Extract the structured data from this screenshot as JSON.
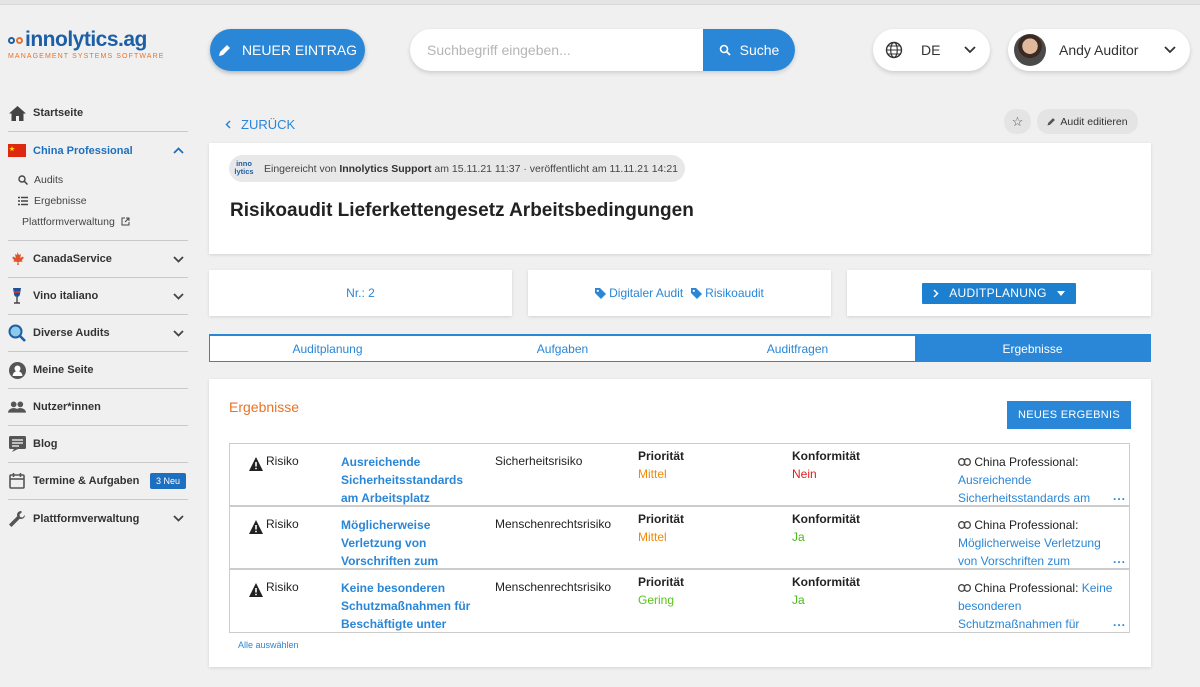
{
  "brand": {
    "name": "innolytics.ag",
    "tagline": "MANAGEMENT SYSTEMS SOFTWARE",
    "logo_icon": "innolytics-logo-icon"
  },
  "header": {
    "new_entry_label": "NEUER EINTRAG",
    "search_placeholder": "Suchbegriff eingeben...",
    "search_button_label": "Suche",
    "language": "DE",
    "user_name": "Andy Auditor"
  },
  "sidebar": {
    "items": [
      {
        "label": "Startseite",
        "icon": "home-icon"
      },
      {
        "label": "China Professional",
        "icon": "china-flag-icon",
        "expanded": true,
        "sub": [
          {
            "label": "Audits",
            "icon": "search-icon"
          },
          {
            "label": "Ergebnisse",
            "icon": "list-icon"
          },
          {
            "label": "Plattformverwaltung",
            "icon": "external-link-icon"
          }
        ]
      },
      {
        "label": "CanadaService",
        "icon": "maple-leaf-icon"
      },
      {
        "label": "Vino italiano",
        "icon": "wine-icon"
      },
      {
        "label": "Diverse Audits",
        "icon": "magnifier-icon"
      },
      {
        "label": "Meine Seite",
        "icon": "person-icon"
      },
      {
        "label": "Nutzer*innen",
        "icon": "people-icon"
      },
      {
        "label": "Blog",
        "icon": "blog-icon"
      },
      {
        "label": "Termine & Aufgaben",
        "icon": "calendar-icon",
        "badge": "3 Neu"
      },
      {
        "label": "Plattformverwaltung",
        "icon": "wrench-icon"
      }
    ]
  },
  "page": {
    "back_label": "ZURÜCK",
    "edit_label": "Audit editieren",
    "submitted_prefix": "Eingereicht von",
    "submitted_by": "Innolytics Support",
    "submitted_at": "am 15.11.21 11:37 · veröffentlicht am 11.11.21 14:21",
    "mini_logo_top": "inno",
    "mini_logo_bottom": "lytics",
    "title": "Risikoaudit Lieferkettengesetz Arbeitsbedingungen",
    "number": "Nr.: 2",
    "tags": [
      "Digitaler Audit",
      "Risikoaudit"
    ],
    "status_button": "AUDITPLANUNG"
  },
  "tabs": [
    {
      "label": "Auditplanung",
      "active": false
    },
    {
      "label": "Aufgaben",
      "active": false
    },
    {
      "label": "Auditfragen",
      "active": false
    },
    {
      "label": "Ergebnisse",
      "active": true
    }
  ],
  "results": {
    "title": "Ergebnisse",
    "new_button": "NEUES ERGEBNIS",
    "select_all": "Alle auswählen",
    "priority_label": "Priorität",
    "conformity_label": "Konformität",
    "link_prefix": "China Professional:",
    "colors": {
      "Mittel": "#f08a00",
      "Gering": "#5ac31a",
      "Nein": "#e02020",
      "Ja": "#4cba1a"
    },
    "rows": [
      {
        "type": "Risiko",
        "title": "Ausreichende Sicherheitsstandards am Arbeitsplatz",
        "category": "Sicherheitsrisiko",
        "priority": "Mittel",
        "conformity": "Nein",
        "link": "Ausreichende Sicherheitsstandards am"
      },
      {
        "type": "Risiko",
        "title": "Möglicherweise Verletzung von Vorschriften zum",
        "category": "Menschenrechtsrisiko",
        "priority": "Mittel",
        "conformity": "Ja",
        "link": "Möglicherweise Verletzung von Vorschriften zum"
      },
      {
        "type": "Risiko",
        "title": "Keine besonderen Schutzmaßnahmen für Beschäftigte unter",
        "category": "Menschenrechtsrisiko",
        "priority": "Gering",
        "conformity": "Ja",
        "link": "Keine besonderen Schutzmaßnahmen für"
      }
    ]
  }
}
